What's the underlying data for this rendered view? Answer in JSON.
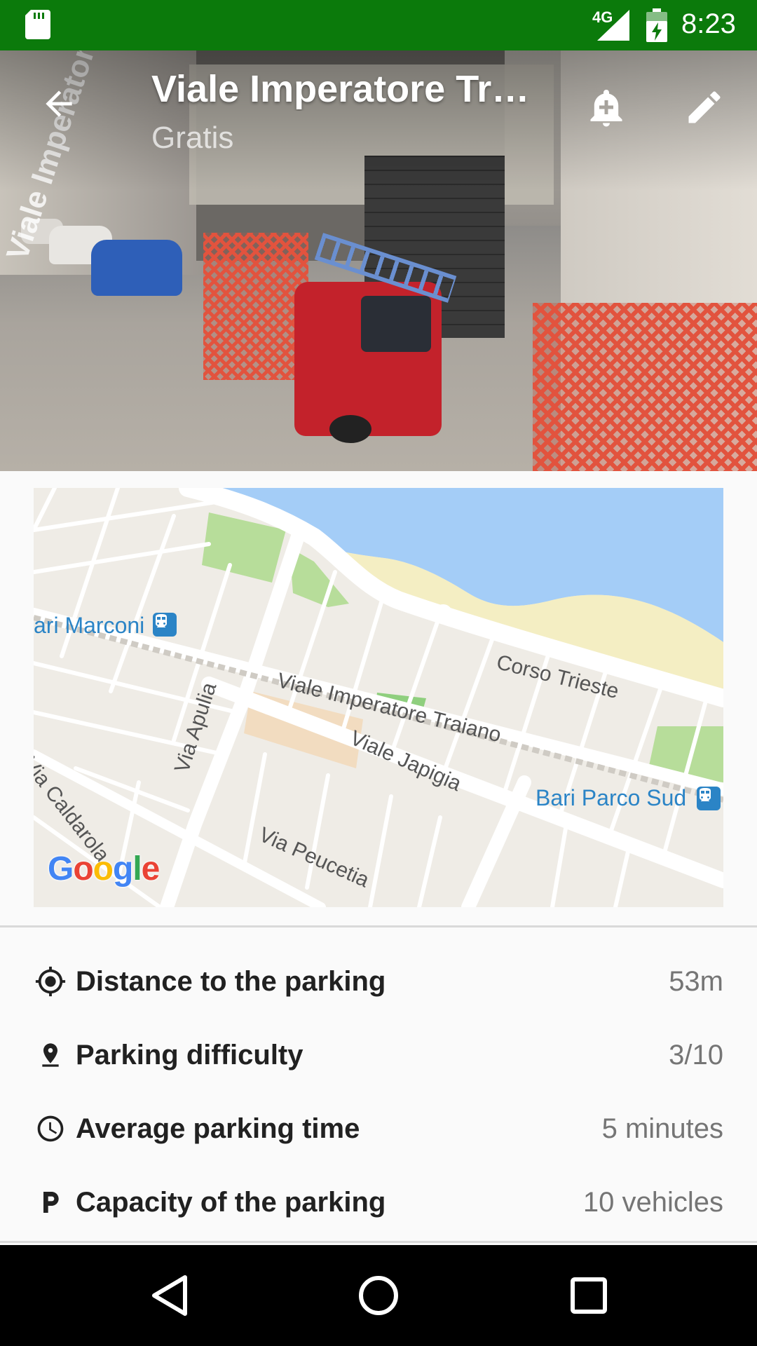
{
  "status_bar": {
    "network": "4G",
    "time": "8:23",
    "color": "#0b7a0b"
  },
  "header": {
    "title": "Viale Imperatore Tr…",
    "subtitle": "Gratis"
  },
  "map": {
    "labels": {
      "marconi": "ari Marconi",
      "corso_trieste": "Corso Trieste",
      "viale_imperatore": "Viale Imperatore Traiano",
      "viale_japigia": "Viale Japigia",
      "via_apulia": "Via Apulia",
      "via_caldarola": "Via Caldarola",
      "via_peucetia": "Via Peucetia",
      "bari_parco_sud": "Bari Parco Sud"
    },
    "logo": [
      "G",
      "o",
      "o",
      "g",
      "l",
      "e"
    ],
    "water_color": "#a4cdf7",
    "park_color": "#b7dd9a",
    "beach_color": "#f4eec3"
  },
  "info": [
    {
      "icon": "crosshair-icon",
      "label": "Distance to the parking",
      "value": "53m"
    },
    {
      "icon": "pin-icon",
      "label": "Parking difficulty",
      "value": "3/10"
    },
    {
      "icon": "clock-icon",
      "label": "Average parking time",
      "value": "5 minutes"
    },
    {
      "icon": "parking-p-icon",
      "label": "Capacity of the parking",
      "value": "10 vehicles"
    }
  ],
  "hero": {
    "street_text": "Viale Imperatore"
  }
}
